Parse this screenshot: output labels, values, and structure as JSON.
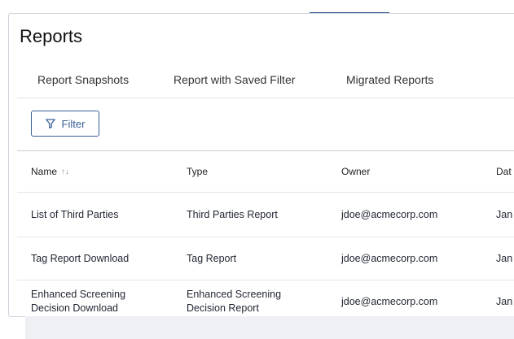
{
  "page": {
    "title": "Reports"
  },
  "tabs": [
    {
      "label": "Report Snapshots",
      "active": true
    },
    {
      "label": "Report with Saved Filter",
      "active": false
    },
    {
      "label": "Migrated Reports",
      "active": false
    }
  ],
  "toolbar": {
    "filter_label": "Filter",
    "filter_icon": "funnel-icon"
  },
  "table": {
    "columns": [
      {
        "label": "Name",
        "sortable": true
      },
      {
        "label": "Type"
      },
      {
        "label": "Owner"
      },
      {
        "label": "Dat"
      }
    ],
    "rows": [
      {
        "name": [
          "List of Third Parties"
        ],
        "type": [
          "Third Parties Report"
        ],
        "owner": "jdoe@acmecorp.com",
        "date": "Jan"
      },
      {
        "name": [
          "Tag Report Download"
        ],
        "type": [
          "Tag Report"
        ],
        "owner": "jdoe@acmecorp.com",
        "date": "Jan"
      },
      {
        "name": [
          "Enhanced Screening",
          "Decision Download"
        ],
        "type": [
          "Enhanced Screening",
          "Decision Report"
        ],
        "owner": "jdoe@acmecorp.com",
        "date": "Jan"
      }
    ]
  },
  "colors": {
    "accent": "#3b5f97",
    "divider": "#e3e5ea"
  }
}
